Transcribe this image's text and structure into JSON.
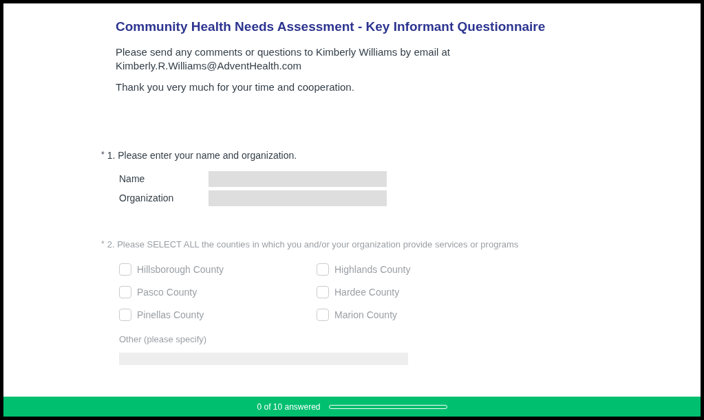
{
  "title": "Community Health Needs Assessment - Key Informant Questionnaire",
  "intro": [
    "Please send any comments or questions to Kimberly Williams by email at Kimberly.R.Williams@AdventHealth.com",
    "Thank you very much for your time and cooperation."
  ],
  "questions": [
    {
      "kind": "text",
      "marker": "*",
      "faded": false,
      "label": "1. Please enter your name and organization.",
      "fields": [
        {
          "label": "Name"
        },
        {
          "label": "Organization"
        }
      ]
    },
    {
      "kind": "checkbox",
      "marker": "*",
      "faded": true,
      "label": "2. Please SELECT ALL the counties in which you and/or your organization provide services or programs",
      "options": [
        {
          "label": "Hillsborough County",
          "checked": false
        },
        {
          "label": "Highlands County",
          "checked": false
        },
        {
          "label": "Pasco County",
          "checked": false
        },
        {
          "label": "Hardee County",
          "checked": false
        },
        {
          "label": "Pinellas County",
          "checked": false
        },
        {
          "label": "Marion County",
          "checked": false
        }
      ],
      "other": {
        "label": "Other (please specify)"
      }
    }
  ],
  "progress": {
    "text": "0 of 10 answered",
    "level": 0
  }
}
